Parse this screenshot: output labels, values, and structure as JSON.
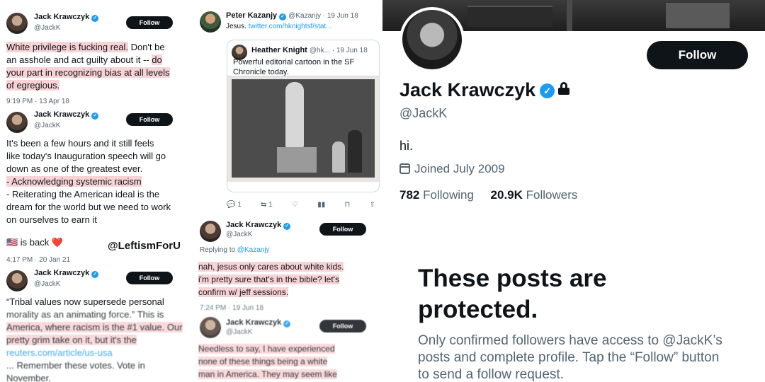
{
  "collage": {
    "tweet1": {
      "name": "Jack Krawczyk",
      "handle": "@JackK",
      "follow": "Follow",
      "line1": "White privilege is fucking real.",
      "line1b": " Don't be",
      "line2": "an asshole and act guilty about it -- ",
      "line2b": "do",
      "line3": "your part in recognizing bias at all levels",
      "line4": "of egregious.",
      "time": "9:19 PM · 13 Apr 18"
    },
    "tweet2": {
      "name": "Jack Krawczyk",
      "handle": "@JackK",
      "follow": "Follow",
      "lines": [
        "It's been a few hours and it still feels",
        "like today's Inauguration speech will go",
        "down as one of the greatest ever."
      ],
      "hl_line": "- Acknowledging systemic racism",
      "lines2": [
        "- Reiterating the American ideal is the",
        "dream for the world but we need to work",
        "on ourselves to earn it"
      ],
      "back": "🇺🇸 is back ❤️",
      "time": "4:17 PM · 20 Jan 21"
    },
    "watermark": "@LeftismForU",
    "tweet3": {
      "name": "Jack Krawczyk",
      "handle": "@JackK",
      "follow": "Follow",
      "line1": "“Tribal values now supersede personal",
      "line2": "morality as an animating force.” This is",
      "line3": "America, where racism is the #1 value. Our",
      "line4": "pretty grim take on it, but it's the",
      "link": "reuters.com/article/us-usa",
      "line5": "... Remember these votes. Vote in",
      "line6": "November."
    },
    "tweet4": {
      "name": "Peter Kazanjy",
      "handle": "@Kazanjy · 19 Jun 18",
      "text": "Jesus. ",
      "link": "twitter.com/hknightsf/stat...",
      "quote_name": "Heather Knight",
      "quote_handle": "@hk... · 19 Jun 18",
      "quote_line1": "Powerful editorial cartoon in the SF",
      "quote_line2": "Chronicle today.",
      "replies": "1",
      "retweets": "1"
    },
    "tweet5": {
      "name": "Jack Krawczyk",
      "handle": "@JackK",
      "follow": "Follow",
      "replying": "Replying to ",
      "replying_to": "@Kazanjy",
      "line1": "nah, jesus only cares about white kids.",
      "line2": "i'm pretty sure that's in the bible? let's",
      "line3": "confirm w/ jeff sessions.",
      "time": "7:24 PM · 19 Jun 18"
    },
    "tweet6": {
      "name": "Jack Krawczyk",
      "handle": "@JackK",
      "follow": "Follow",
      "line1": "Needless to say, I have experienced",
      "line2": "none of these things being a white",
      "line3": "man in America. They may seem like"
    }
  },
  "profile": {
    "follow": "Follow",
    "name": "Jack Krawczyk",
    "handle": "@JackK",
    "bio": "hi.",
    "joined": "Joined July 2009",
    "following_count": "782",
    "following_label": "Following",
    "followers_count": "20.9K",
    "followers_label": "Followers",
    "protected_title": "These posts are protected.",
    "protected_body": "Only confirmed followers have access to @JackK’s posts and complete profile. Tap the “Follow” button to send a follow request."
  },
  "colors": {
    "accent": "#1d9bf0",
    "highlight": "#f8d3d6",
    "text": "#0f1419",
    "muted": "#536471"
  },
  "icons": [
    "verified-badge-icon",
    "lock-icon",
    "calendar-icon",
    "reply-icon",
    "retweet-icon",
    "like-icon",
    "views-icon",
    "bookmark-icon",
    "share-icon"
  ]
}
